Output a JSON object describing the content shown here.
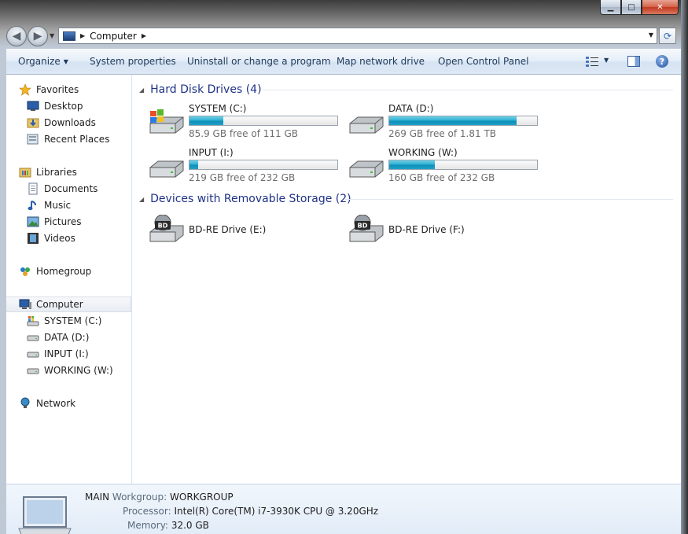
{
  "window": {
    "caption_buttons": {
      "minimize": "▁",
      "maximize": "□",
      "close": "✕"
    }
  },
  "address": {
    "crumb": "Computer"
  },
  "toolbar": {
    "organize": "Organize",
    "system_properties": "System properties",
    "uninstall": "Uninstall or change a program",
    "map_drive": "Map network drive",
    "control_panel": "Open Control Panel",
    "help": "?"
  },
  "sidebar": {
    "favorites": "Favorites",
    "desktop": "Desktop",
    "downloads": "Downloads",
    "recent": "Recent Places",
    "libraries": "Libraries",
    "documents": "Documents",
    "music": "Music",
    "pictures": "Pictures",
    "videos": "Videos",
    "homegroup": "Homegroup",
    "computer": "Computer",
    "drive_c": "SYSTEM (C:)",
    "drive_d": "DATA (D:)",
    "drive_i": "INPUT (I:)",
    "drive_w": "WORKING (W:)",
    "network": "Network"
  },
  "content": {
    "hdd_header": "Hard Disk Drives (4)",
    "removable_header": "Devices with Removable Storage (2)",
    "drives": [
      {
        "name": "SYSTEM (C:)",
        "free": "85.9 GB free of 111 GB",
        "used_fraction": 0.23
      },
      {
        "name": "DATA (D:)",
        "free": "269 GB free of 1.81 TB",
        "used_fraction": 0.86
      },
      {
        "name": "INPUT (I:)",
        "free": "219 GB free of 232 GB",
        "used_fraction": 0.06
      },
      {
        "name": "WORKING (W:)",
        "free": "160 GB free of 232 GB",
        "used_fraction": 0.31
      }
    ],
    "removable": [
      {
        "name": "BD-RE Drive (E:)",
        "badge": "BD"
      },
      {
        "name": "BD-RE Drive (F:)",
        "badge": "BD"
      }
    ]
  },
  "details": {
    "computer_name": "MAIN",
    "workgroup_label": "Workgroup:",
    "workgroup": "WORKGROUP",
    "processor_label": "Processor:",
    "processor": "Intel(R) Core(TM) i7-3930K CPU @ 3.20GHz",
    "memory_label": "Memory:",
    "memory": "32.0 GB"
  },
  "colors": {
    "accent": "#1e3287",
    "bar_fill": "#1ea2c9",
    "selection": "#e8edf3"
  }
}
